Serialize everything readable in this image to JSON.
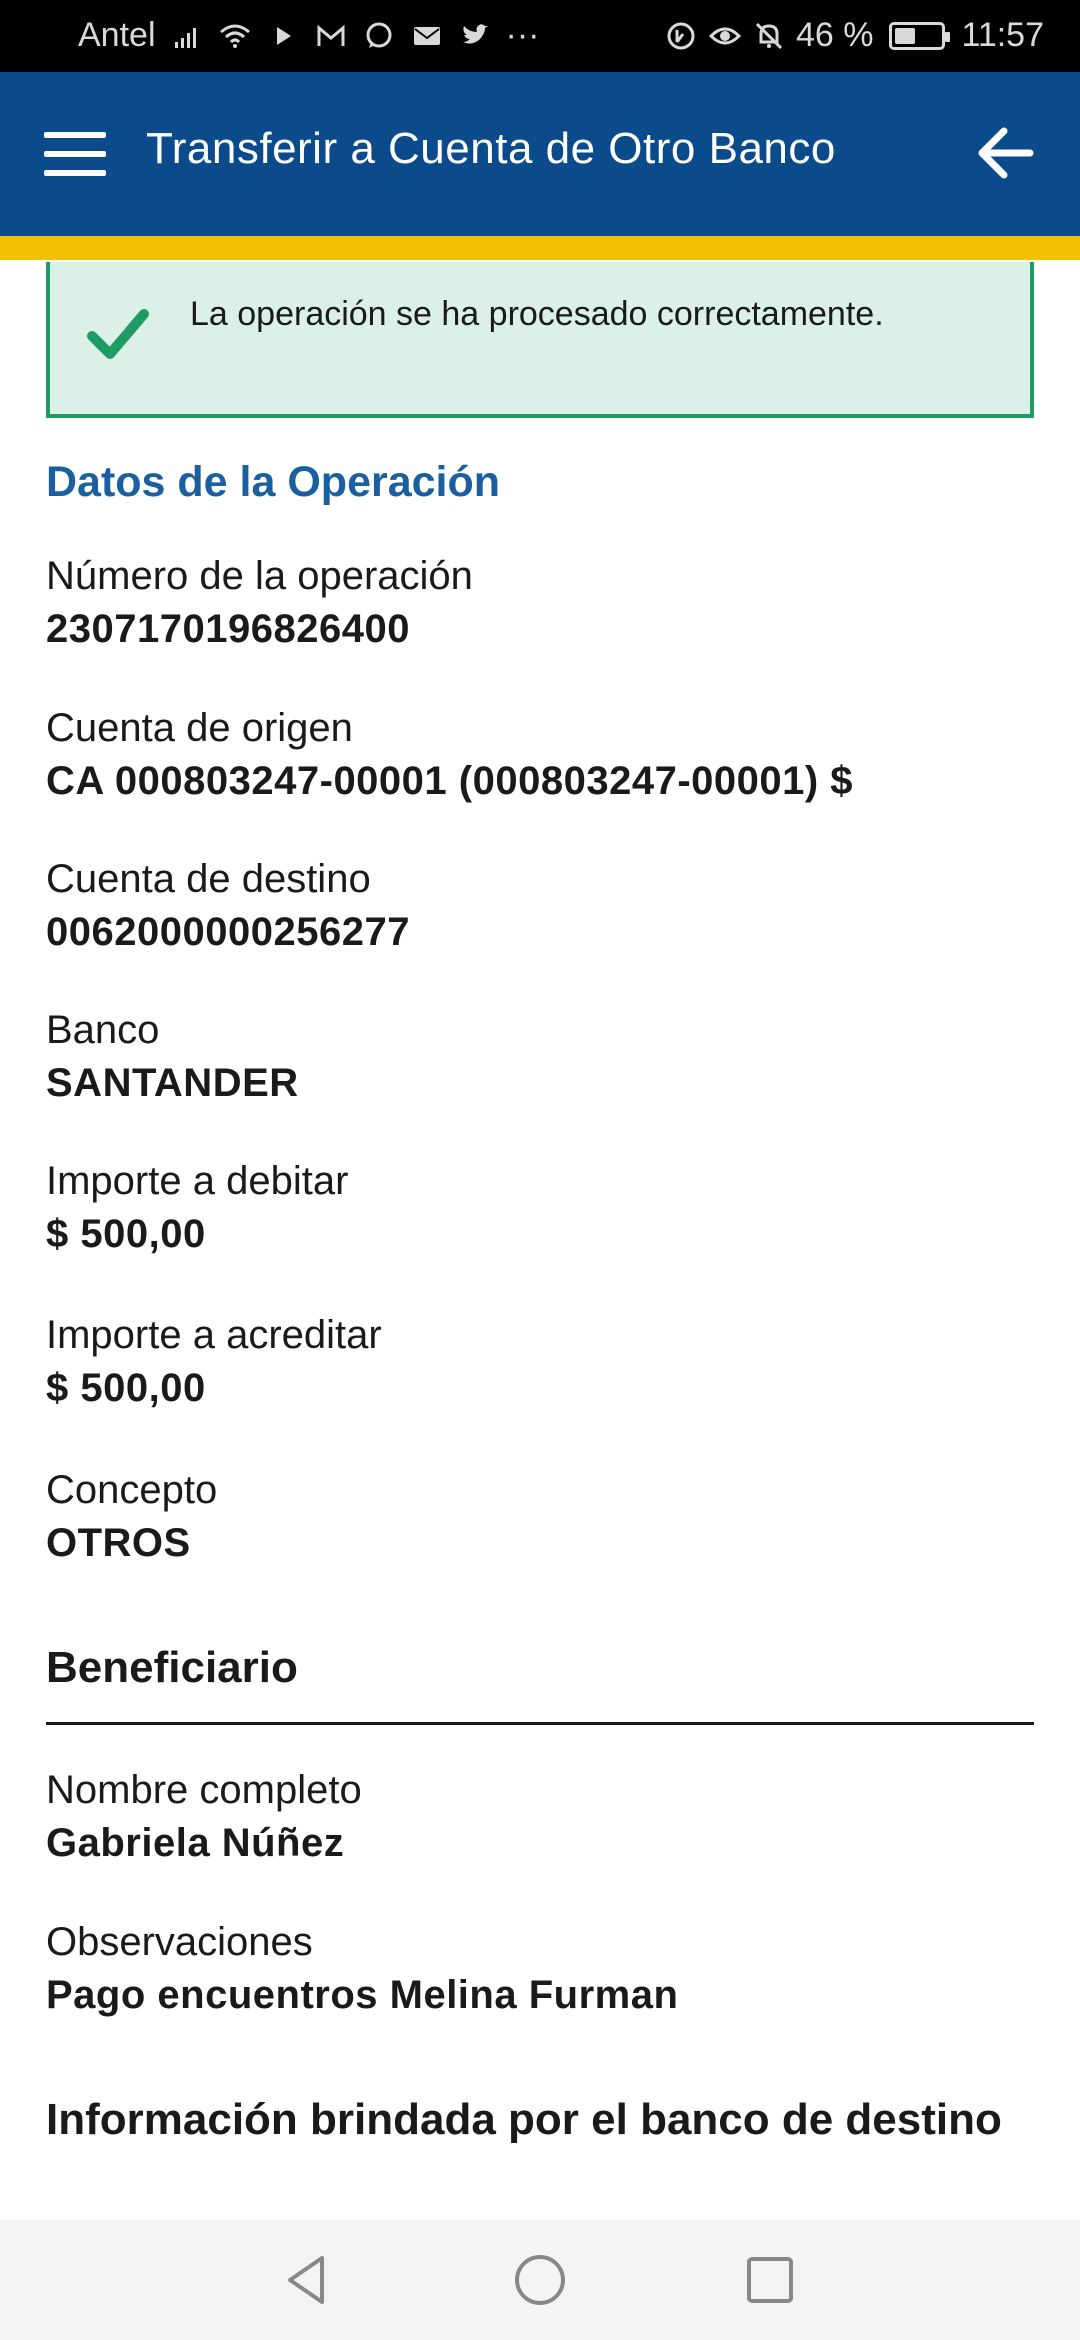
{
  "status_bar": {
    "carrier": "Antel",
    "icons_left": [
      "signal-icon",
      "wifi-icon",
      "play-icon",
      "gmail-icon",
      "whatsapp-icon",
      "mail-icon",
      "twitter-icon",
      "more-dots-icon"
    ],
    "more": "···",
    "icons_right": [
      "data-saver-icon",
      "eye-icon",
      "alarm-off-icon"
    ],
    "battery_percent": "46 %",
    "battery_level": 0.46,
    "time": "11:57"
  },
  "appbar": {
    "title": "Transferir a Cuenta de Otro Banco",
    "color": "#0b4a8b",
    "accent_color": "#f2c200"
  },
  "alert": {
    "message": "La operación se ha procesado correctamente.",
    "color": "#1e9c63"
  },
  "operation": {
    "section_title": "Datos de la Operación",
    "fields": [
      {
        "label": "Número de la operación",
        "value": "2307170196826400"
      },
      {
        "label": "Cuenta de origen",
        "value": "CA 000803247-00001 (000803247-00001) $"
      },
      {
        "label": "Cuenta de destino",
        "value": "0062000000256277"
      },
      {
        "label": "Banco",
        "value": "SANTANDER"
      },
      {
        "label": "Importe a debitar",
        "value": "$ 500,00"
      },
      {
        "label": "Importe a acreditar",
        "value": "$ 500,00"
      },
      {
        "label": "Concepto",
        "value": "OTROS"
      }
    ]
  },
  "beneficiary": {
    "heading": "Beneficiario",
    "fields": [
      {
        "label": "Nombre completo",
        "value": "Gabriela Núñez"
      },
      {
        "label": "Observaciones",
        "value": "Pago encuentros Melina Furman"
      }
    ]
  },
  "bank_info": {
    "heading": "Información brindada por el banco de destino"
  },
  "navbar": {
    "icons": [
      "back-triangle-icon",
      "home-circle-icon",
      "recents-square-icon"
    ]
  }
}
